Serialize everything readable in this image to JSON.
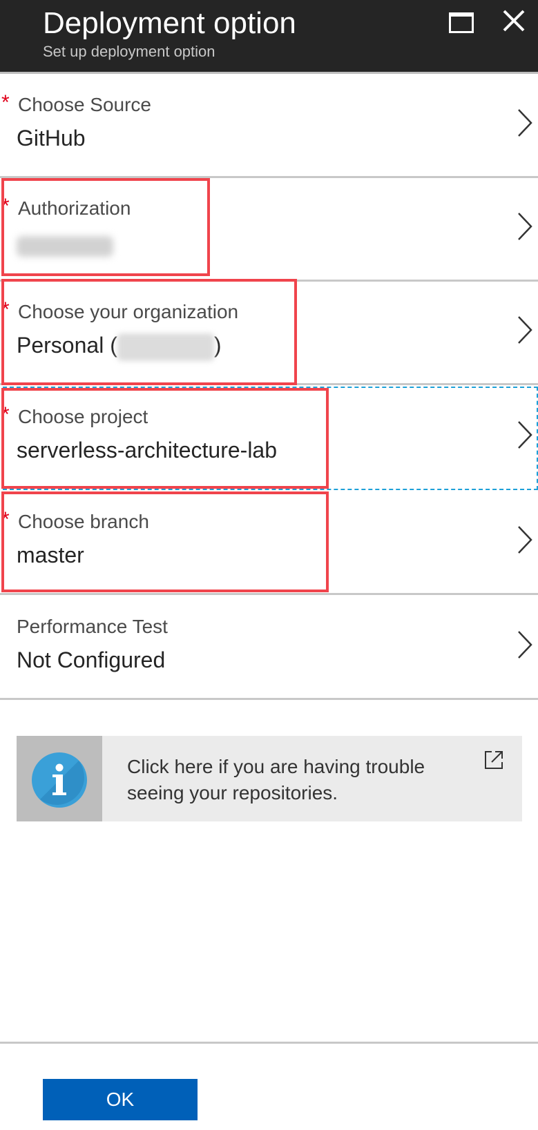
{
  "header": {
    "title": "Deployment option",
    "subtitle": "Set up deployment option",
    "maximize_icon": "maximize-icon",
    "close_icon": "close-icon"
  },
  "rows": [
    {
      "label": "Choose Source",
      "value": "GitHub",
      "required": true
    },
    {
      "label": "Authorization",
      "value": "",
      "required": true,
      "value_obscured": true
    },
    {
      "label": "Choose your organization",
      "value_prefix": "Personal (",
      "value_suffix": ")",
      "required": true
    },
    {
      "label": "Choose project",
      "value": "serverless-architecture-lab",
      "required": true
    },
    {
      "label": "Choose branch",
      "value": "master",
      "required": true
    },
    {
      "label": "Performance Test",
      "value": "Not Configured",
      "required": false
    }
  ],
  "required_marker": "*",
  "info": {
    "text": "Click here if you are having trouble seeing your repositories.",
    "icon": "info-icon",
    "external_icon": "external-link-icon"
  },
  "footer": {
    "ok_label": "OK"
  },
  "colors": {
    "header_bg": "#252525",
    "required": "#e0001a",
    "highlight": "#f0444c",
    "primary_button": "#0060b8",
    "info_icon": "#3aa0d8"
  }
}
